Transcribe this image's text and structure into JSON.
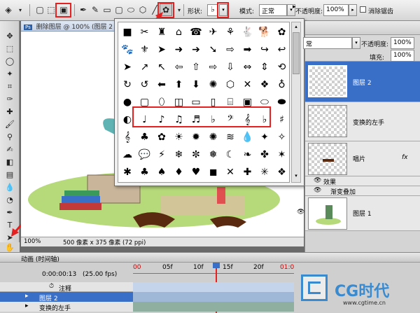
{
  "options_bar": {
    "shape_label": "形状:",
    "mode_label": "模式:",
    "mode_value": "正常",
    "opacity_label": "不透明度:",
    "opacity_value": "100%",
    "antialias_label": "消除锯齿",
    "shape_glyph": "♭"
  },
  "document": {
    "title": "删除图层 @ 100% (图层 2",
    "zoom": "100%",
    "size_info": "500 像素 x 375 像素 (72 ppi)"
  },
  "shape_picker": {
    "rows": [
      [
        "■",
        "✂",
        "♜",
        "⌂",
        "☎",
        "✈",
        "⚘",
        "🐇",
        "🐕",
        "✿"
      ],
      [
        "🐾",
        "⚜",
        "➤",
        "➜",
        "➔",
        "➘",
        "⇨",
        "➡",
        "↪",
        "↩"
      ],
      [
        "➤",
        "↗",
        "↖",
        "⇦",
        "⇧",
        "⇨",
        "⇩",
        "⇔",
        "⇕",
        "⟲"
      ],
      [
        "↻",
        "↺",
        "⬅",
        "⬆",
        "⬇",
        "✺",
        "⬡",
        "✕",
        "❖",
        "♁"
      ],
      [
        "●",
        "▢",
        "⬯",
        "◫",
        "▭",
        "▯",
        "⌸",
        "▣",
        "⬭",
        "⬬"
      ],
      [
        "◐",
        "♩",
        "♪",
        "♫",
        "♬",
        "♭",
        "𝄢",
        "𝄞",
        "♭",
        "♯"
      ],
      [
        "𝄞",
        "♣",
        "✿",
        "☀",
        "✹",
        "✺",
        "≋",
        "💧",
        "✦",
        "✧"
      ],
      [
        "☁",
        "💬",
        "⚡",
        "❄",
        "✼",
        "❅",
        "☾",
        "❧",
        "✤",
        "✶"
      ],
      [
        "✱",
        "♣",
        "♠",
        "♦",
        "♥",
        "◼",
        "✕",
        "✚",
        "✳",
        "❖"
      ]
    ]
  },
  "layers": {
    "blend_mode": "常",
    "opacity_label": "不透明度:",
    "opacity_value": "100%",
    "fill_label": "填充:",
    "fill_value": "100%",
    "items": [
      {
        "name": "图层 2",
        "selected": true
      },
      {
        "name": "变换的左手",
        "selected": false
      },
      {
        "name": "唱片",
        "selected": false
      },
      {
        "name": "图层 1",
        "selected": false
      }
    ],
    "effects_label": "效果",
    "gradient_overlay_label": "渐变叠加",
    "fx_label": "fx"
  },
  "timeline": {
    "title": "动画 (时间轴)",
    "current_time": "0:00:00:13",
    "fps": "(25.00 fps)",
    "ruler_marks": [
      "00",
      "05f",
      "10f",
      "15f",
      "20f",
      "01:0"
    ],
    "comments_label": "注释",
    "tracks": [
      "图层 2",
      "变换的左手"
    ]
  },
  "watermark": {
    "text": "CG时代",
    "site": "www.cgtime.cn"
  },
  "colors": {
    "selection_blue": "#3a6fc8",
    "highlight_red": "#e42020"
  }
}
